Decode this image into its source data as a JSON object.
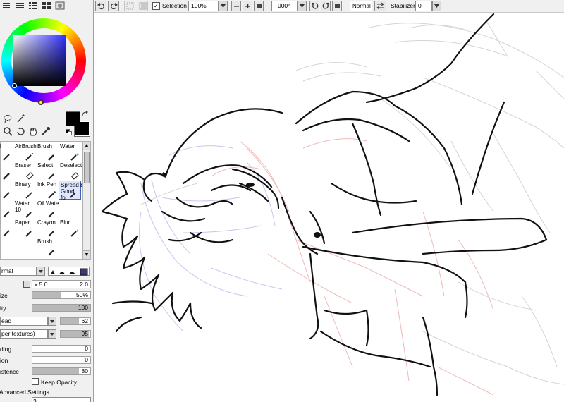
{
  "toolbar": {
    "selection_label": "Selection",
    "selection_checked": true,
    "zoom": "100%",
    "rotation": "+000°",
    "blend_mode": "Normal",
    "stabilizer_label": "Stabilizer",
    "stabilizer_value": "0"
  },
  "tools": [
    {
      "label": "ncil",
      "size": ""
    },
    {
      "label": "AirBrush",
      "size": ""
    },
    {
      "label": "Brush",
      "size": ""
    },
    {
      "label": "Water",
      "size": ""
    },
    {
      "label": "ker",
      "size": ""
    },
    {
      "label": "Eraser",
      "size": ""
    },
    {
      "label": "Select",
      "size": ""
    },
    {
      "label": "Deselect",
      "size": ""
    },
    {
      "label": "ket",
      "size": ""
    },
    {
      "label": "Binary",
      "size": ""
    },
    {
      "label": "Ink Pen",
      "size": ""
    },
    {
      "label": "Spread B",
      "size": "Good fo"
    },
    {
      "label": "er",
      "size": ""
    },
    {
      "label": "Water",
      "size": "10"
    },
    {
      "label": "Oil Wate",
      "size": ""
    },
    {
      "label": "",
      "size": ""
    },
    {
      "label": "ylic",
      "size": ""
    },
    {
      "label": "Paper",
      "size": ""
    },
    {
      "label": "Crayon",
      "size": ""
    },
    {
      "label": "Blur",
      "size": ""
    },
    {
      "label": "",
      "size": ""
    },
    {
      "label": "",
      "size": ""
    },
    {
      "label": "Brush",
      "size": ""
    },
    {
      "label": "",
      "size": ""
    }
  ],
  "brush": {
    "blend_mode": "rmal",
    "size_multiplier": "x 5.0",
    "min_size": "2.0",
    "size_label": "ize",
    "size_value": "50%",
    "size_fill": 0.5,
    "density_label": "ity",
    "density_value": "100",
    "density_fill": 1.0,
    "shape_select": "ead",
    "shape_value": "62",
    "shape_fill": 0.62,
    "texture_select": "per textures)",
    "texture_value": "95",
    "texture_fill": 0.95,
    "blending_label": "ding",
    "blending_value": "0",
    "blending_fill": 0,
    "dilution_label": "ion",
    "dilution_value": "0",
    "dilution_fill": 0,
    "persistence_label": "istence",
    "persistence_value": "80",
    "persistence_fill": 0.8,
    "keep_opacity_label": "Keep Opacity",
    "advanced_label": "Advanced Settings",
    "bottom_value": "3"
  }
}
